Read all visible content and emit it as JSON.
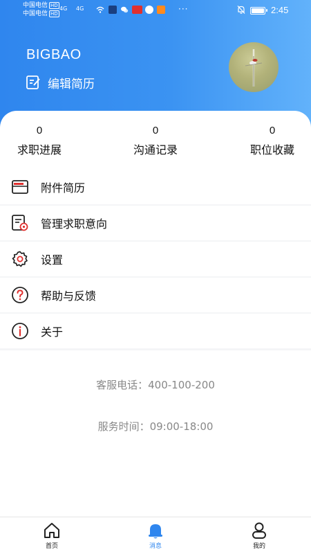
{
  "status_bar": {
    "carrier_1": "中国电信",
    "carrier_2": "中国电信",
    "hd_badge": "HD",
    "signal_label": "4G",
    "notification_icons": [
      "wifi-icon",
      "app-icon",
      "wechat-icon",
      "toutiao-icon",
      "app-icon",
      "video-icon"
    ],
    "more": "···",
    "time": "2:45",
    "battery_level": 1.0
  },
  "profile": {
    "username": "BIGBAO",
    "edit_resume_label": "编辑简历",
    "edit_icon": "edit-icon",
    "avatar": "avatar-image"
  },
  "stats": [
    {
      "count": "0",
      "label": "求职进展"
    },
    {
      "count": "0",
      "label": "沟通记录"
    },
    {
      "count": "0",
      "label": "职位收藏"
    }
  ],
  "menu": [
    {
      "label": "附件简历",
      "icon": "folder-icon"
    },
    {
      "label": "管理求职意向",
      "icon": "document-settings-icon"
    },
    {
      "label": "设置",
      "icon": "gear-icon"
    },
    {
      "label": "帮助与反馈",
      "icon": "help-icon"
    },
    {
      "label": "关于",
      "icon": "info-icon"
    }
  ],
  "contact": {
    "phone_label": "客服电话：400-100-200",
    "hours_label": "服务时间：09:00-18:00"
  },
  "tabbar": {
    "items": [
      {
        "label": "首页",
        "icon": "home-icon",
        "active": false
      },
      {
        "label": "消息",
        "icon": "bell-icon",
        "active": true
      },
      {
        "label": "我的",
        "icon": "user-icon",
        "active": false
      }
    ]
  },
  "colors": {
    "header_gradient_start": "#2f86ee",
    "header_gradient_end": "#62b2fb",
    "accent": "#2f86ee",
    "icon_red": "#e0302e",
    "muted_text": "#888888"
  }
}
